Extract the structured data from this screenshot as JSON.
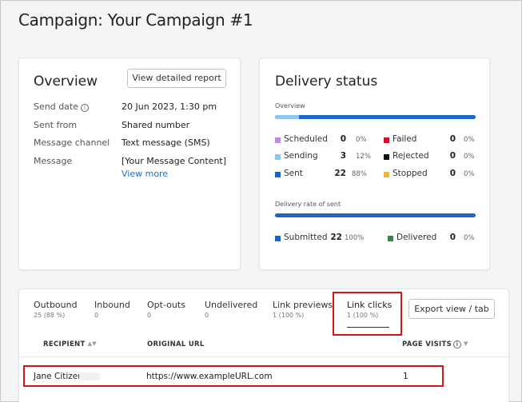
{
  "page": {
    "title": "Campaign: Your Campaign #1"
  },
  "overview": {
    "heading": "Overview",
    "report_button": "View detailed report",
    "rows": [
      {
        "label": "Send date",
        "value": "20 Jun 2023, 1:30 pm",
        "info_icon": true
      },
      {
        "label": "Sent from",
        "value": "Shared number"
      },
      {
        "label": "Message channel",
        "value": "Text message (SMS)"
      },
      {
        "label": "Message",
        "value": "[Your Message Content]"
      }
    ],
    "view_more_link": "View more"
  },
  "delivery": {
    "heading": "Delivery status",
    "overview_label": "Overview",
    "overview_sending_fraction": 0.12,
    "statuses_left": [
      {
        "label": "Scheduled",
        "count": "0",
        "pct": "0%",
        "color": "#b88de6"
      },
      {
        "label": "Sending",
        "count": "3",
        "pct": "12%",
        "color": "#8ec7ef"
      },
      {
        "label": "Sent",
        "count": "22",
        "pct": "88%",
        "color": "#1967c8"
      }
    ],
    "statuses_right": [
      {
        "label": "Failed",
        "count": "0",
        "pct": "0%",
        "color": "#c8102e"
      },
      {
        "label": "Rejected",
        "count": "0",
        "pct": "0%",
        "color": "#111111"
      },
      {
        "label": "Stopped",
        "count": "0",
        "pct": "0%",
        "color": "#f2b43a"
      }
    ],
    "rate_label": "Delivery rate of sent",
    "rate_statuses": [
      {
        "label": "Submitted",
        "count": "22",
        "pct": "100%",
        "color": "#1967c8"
      },
      {
        "label": "Delivered",
        "count": "0",
        "pct": "0%",
        "color": "#2e8b3a"
      }
    ]
  },
  "tabs": [
    {
      "label": "Outbound",
      "sub": "25 (88 %)"
    },
    {
      "label": "Inbound",
      "sub": "0"
    },
    {
      "label": "Opt-outs",
      "sub": "0"
    },
    {
      "label": "Undelivered",
      "sub": "0"
    },
    {
      "label": "Link previews",
      "sub": "1 (100 %)"
    },
    {
      "label": "Link clicks",
      "sub": "1 (100 %)"
    }
  ],
  "active_tab": "Link clicks",
  "export_button": "Export view / tab",
  "table": {
    "columns": [
      "RECIPIENT",
      "ORIGINAL URL",
      "PAGE VISITS"
    ],
    "rows": [
      {
        "recipient": "Jane Citizen",
        "url": "https://www.exampleURL.com",
        "visits": "1"
      }
    ]
  },
  "colors": {
    "highlight": "#d6141b",
    "link": "#1a6fd1",
    "bar": "#1967c8"
  }
}
